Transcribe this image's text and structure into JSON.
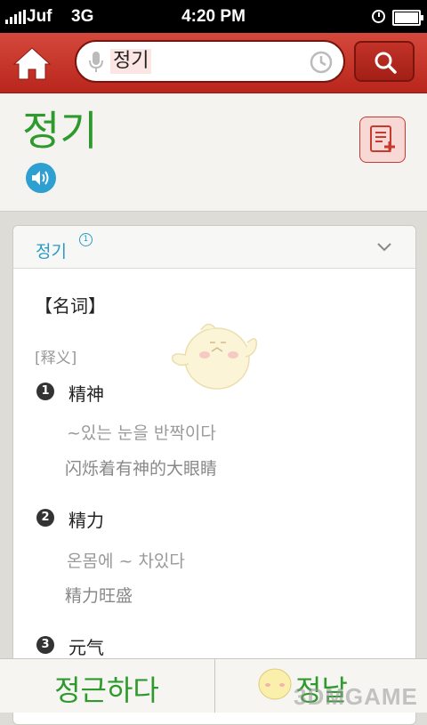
{
  "status_bar": {
    "carrier": "Juf",
    "network": "3G",
    "time": "4:20 PM"
  },
  "search": {
    "query": "정기"
  },
  "header": {
    "headword": "정기"
  },
  "entry": {
    "word": "정기",
    "superscript": "1",
    "part_of_speech": "【名词】",
    "gloss_label": "[释义]",
    "senses": [
      {
        "number": "1",
        "text": "精神",
        "examples": [
          {
            "ko": "~있는 눈을 반짝이다",
            "zh": "闪烁着有神的大眼睛"
          }
        ]
      },
      {
        "number": "2",
        "text": "精力",
        "examples": [
          {
            "ko": "온몸에 ~ 차있다",
            "zh": "精力旺盛"
          }
        ]
      },
      {
        "number": "3",
        "text": "元气",
        "examples": []
      }
    ]
  },
  "bottom_nav": {
    "prev_word": "정근하다",
    "next_word": "정날"
  },
  "watermark": "3DMGAME",
  "colors": {
    "accent_red": "#c0392b",
    "headword_green": "#2e9a2e",
    "link_blue": "#2a9bc8"
  }
}
